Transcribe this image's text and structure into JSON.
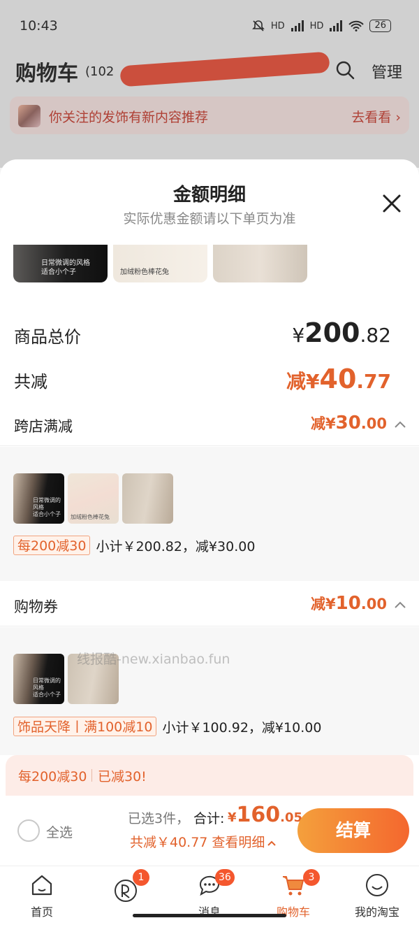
{
  "status_bar": {
    "time": "10:43",
    "network_1": "HD",
    "network_2": "HD",
    "battery": "26"
  },
  "cart_header": {
    "title": "购物车",
    "count": "(102",
    "manage_label": "管理"
  },
  "banner": {
    "text": "你关注的发饰有新内容推荐",
    "link": "去看看"
  },
  "sheet": {
    "title": "金额明细",
    "subtitle": "实际优惠金额请以下单页为准",
    "strip_captions": [
      "日常微调的风格\n适合小个子",
      "加绒粉色棒花兔"
    ]
  },
  "summary": {
    "total_label": "商品总价",
    "total_currency": "¥",
    "total_int": "200",
    "total_dec": ".82",
    "reduce_label": "共减",
    "reduce_prefix": "减¥",
    "reduce_int": "40",
    "reduce_dec": ".77"
  },
  "cross_store": {
    "label": "跨店满减",
    "value_prefix": "减¥",
    "value_int": "30",
    "value_dec": ".00",
    "tag": "每200减30",
    "subtotal": "小计￥200.82，减¥30.00",
    "thumb_caption_1": "日常微调的风格\n适合小个子",
    "thumb_caption_2": "加绒粉色棒花兔"
  },
  "coupon": {
    "label": "购物券",
    "value_prefix": "减¥",
    "value_int": "10",
    "value_dec": ".00",
    "tag": "饰品天降丨满100减10",
    "subtotal": "小计￥100.92，减¥10.00",
    "thumb_caption_1": "日常微调的风格\n适合小个子"
  },
  "watermark": "线报酷-new.xianbao.fun",
  "promo": {
    "left": "每200减30",
    "right": "已减30!"
  },
  "checkout": {
    "select_all": "全选",
    "selected_info": "已选3件，",
    "total_label": "合计:",
    "total_prefix": "¥",
    "total_int": "160",
    "total_dec": ".05",
    "reduce_detail": "共减￥40.77  查看明细",
    "button": "结算"
  },
  "tabs": [
    {
      "label": "首页",
      "icon": "home-icon",
      "badge": ""
    },
    {
      "label": "",
      "icon": "circle-logo-icon",
      "badge": "1"
    },
    {
      "label": "消息",
      "icon": "message-icon",
      "badge": "36"
    },
    {
      "label": "购物车",
      "icon": "cart-icon",
      "badge": "3"
    },
    {
      "label": "我的淘宝",
      "icon": "smile-icon",
      "badge": ""
    }
  ],
  "colors": {
    "accent": "#e2622c",
    "badge": "#f4572e",
    "checkout_gradient_start": "#f4a03c",
    "checkout_gradient_end": "#f4672e"
  }
}
